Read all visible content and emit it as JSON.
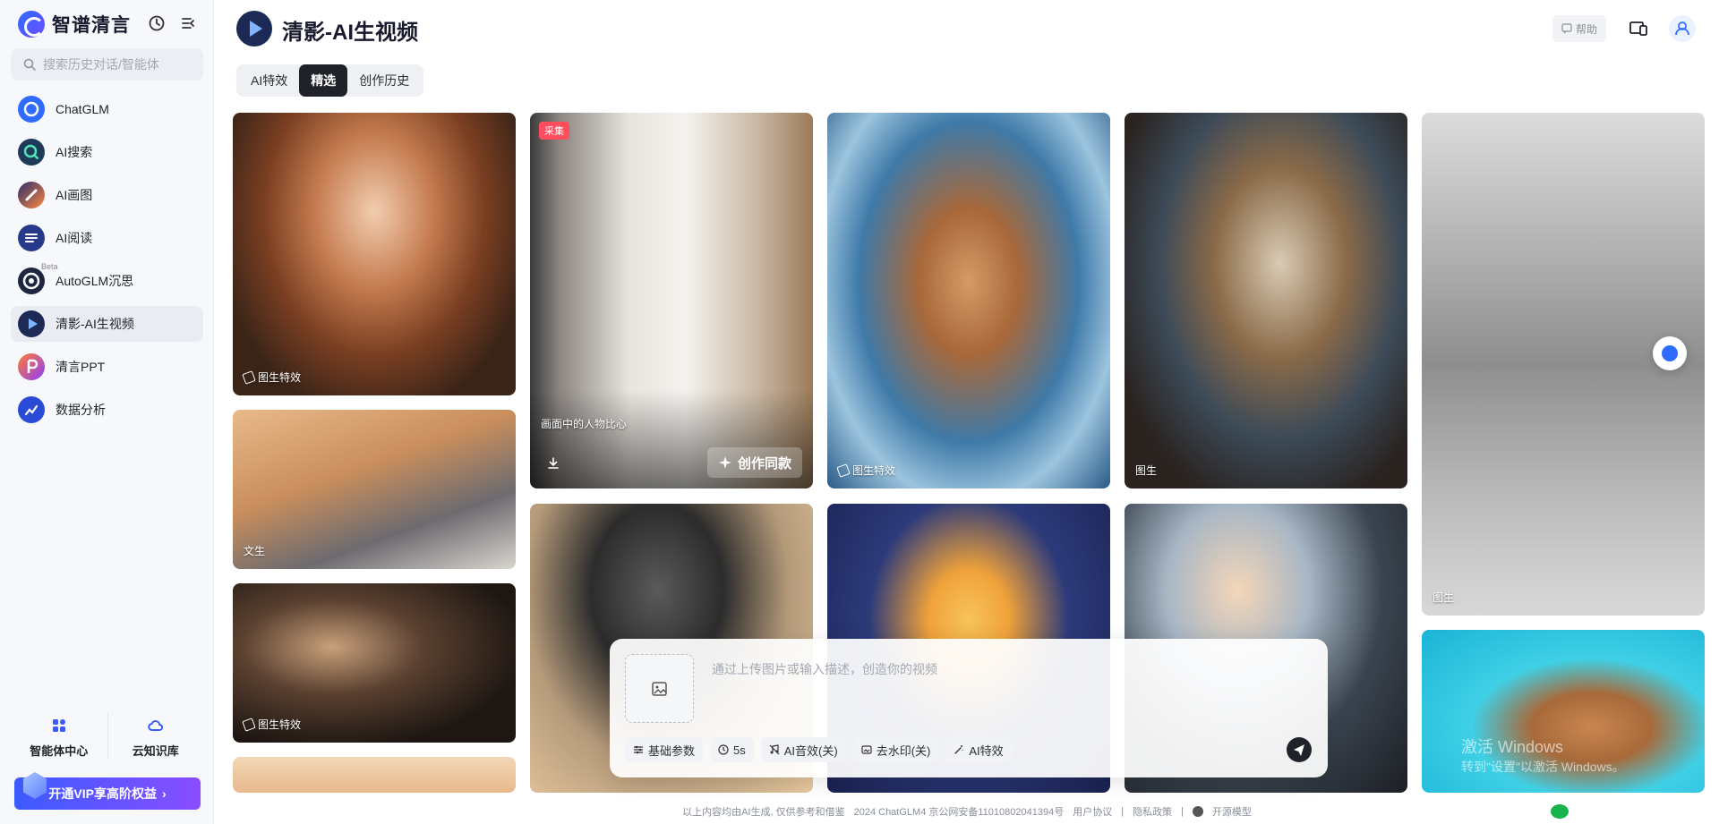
{
  "sidebar": {
    "brand": "智谱清言",
    "search_placeholder": "搜索历史对话/智能体",
    "items": [
      {
        "label": "ChatGLM",
        "icon": "chatglm-icon",
        "color": "#2f6bff"
      },
      {
        "label": "AI搜索",
        "icon": "ai-search-icon",
        "color": "#1aa57f"
      },
      {
        "label": "AI画图",
        "icon": "ai-draw-icon",
        "color": "#6a5cff"
      },
      {
        "label": "AI阅读",
        "icon": "ai-read-icon",
        "color": "#273a8a"
      },
      {
        "label": "AutoGLM沉思",
        "icon": "autoglm-icon",
        "color": "#1f2640",
        "badge": "Beta"
      },
      {
        "label": "清影-AI生视频",
        "icon": "qingying-icon",
        "color": "#1d2a55"
      },
      {
        "label": "清言PPT",
        "icon": "ppt-icon",
        "color": "#8f3dff"
      },
      {
        "label": "数据分析",
        "icon": "data-analysis-icon",
        "color": "#2a4bd6"
      }
    ],
    "tools": [
      {
        "label": "智能体中心",
        "icon": "agent-center-icon"
      },
      {
        "label": "云知识库",
        "icon": "cloud-kb-icon"
      }
    ],
    "vip_label": "开通VIP享高阶权益"
  },
  "header": {
    "title": "清影-AI生视频",
    "help_label": "帮助"
  },
  "tabs": [
    {
      "label": "AI特效",
      "active": false
    },
    {
      "label": "精选",
      "active": true
    },
    {
      "label": "创作历史",
      "active": false
    }
  ],
  "cards": {
    "c1": {
      "tag": "图生特效"
    },
    "c2": {
      "tag": "文生"
    },
    "c3": {
      "tag": "图生特效"
    },
    "c5": {
      "collect": "采集",
      "caption": "画面中的人物比心",
      "action": "创作同款"
    },
    "c7": {
      "tag": "图生特效"
    },
    "c9": {
      "tag": "图生"
    },
    "c11": {
      "tag": "图生"
    }
  },
  "prompt": {
    "placeholder": "通过上传图片或输入描述，创造你的视频",
    "options": [
      {
        "label": "基础参数",
        "icon": "sliders-icon"
      },
      {
        "label": "5s",
        "icon": "clock-icon"
      },
      {
        "label": "AI音效(关)",
        "icon": "music-icon"
      },
      {
        "label": "去水印(关)",
        "icon": "watermark-icon"
      },
      {
        "label": "AI特效",
        "icon": "magic-icon"
      }
    ]
  },
  "watermark": {
    "line1": "激活 Windows",
    "line2": "转到\"设置\"以激活 Windows。"
  },
  "footer": {
    "disclaimer": "以上内容均由AI生成, 仅供参考和借鉴",
    "icp": "2024 ChatGLM4 京公网安备11010802041394号",
    "user_agreement": "用户协议",
    "privacy": "隐私政策",
    "open_model": "开源模型"
  }
}
